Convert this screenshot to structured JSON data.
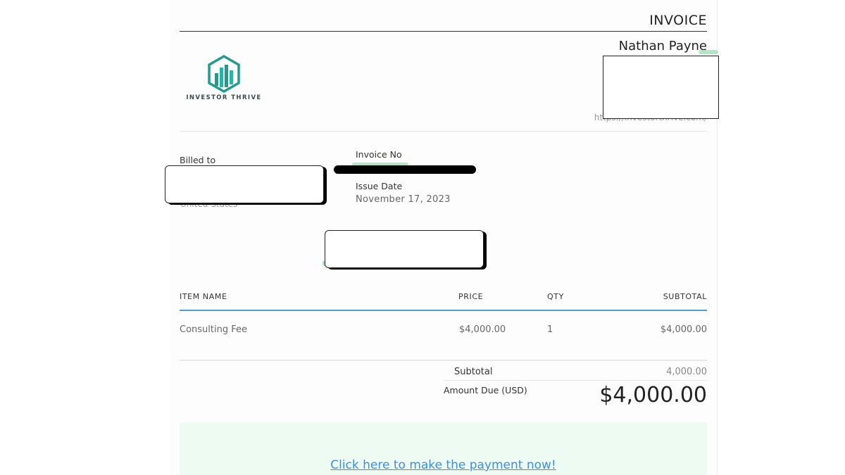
{
  "invoice": {
    "title": "INVOICE",
    "sender_name": "Nathan Payne",
    "website": "https://investorthrive.com/",
    "logo": {
      "text": "INVESTOR THRIVE",
      "color": "#1f9b8f"
    }
  },
  "billing": {
    "billed_to_label": "Billed to",
    "billed_to_country": "United States",
    "invoice_no_label": "Invoice No",
    "issue_date_label": "Issue Date",
    "issue_date_value": "November 17, 2023"
  },
  "table": {
    "headers": [
      "ITEM NAME",
      "PRICE",
      "QTY",
      "SUBTOTAL"
    ],
    "rows": [
      {
        "item": "Consulting Fee",
        "price": "$4,000.00",
        "qty": "1",
        "subtotal": "$4,000.00"
      }
    ]
  },
  "summary": {
    "subtotal_label": "Subtotal",
    "subtotal_value": "4,000.00",
    "amount_due_label": "Amount Due (USD)",
    "amount_due_value": "$4,000.00"
  },
  "payment": {
    "link_text": "Click here to make the payment now!"
  },
  "colors": {
    "accent_rule": "#4a9fd6",
    "link": "#3d8fe0",
    "payment_bg": "#edfbf2"
  }
}
